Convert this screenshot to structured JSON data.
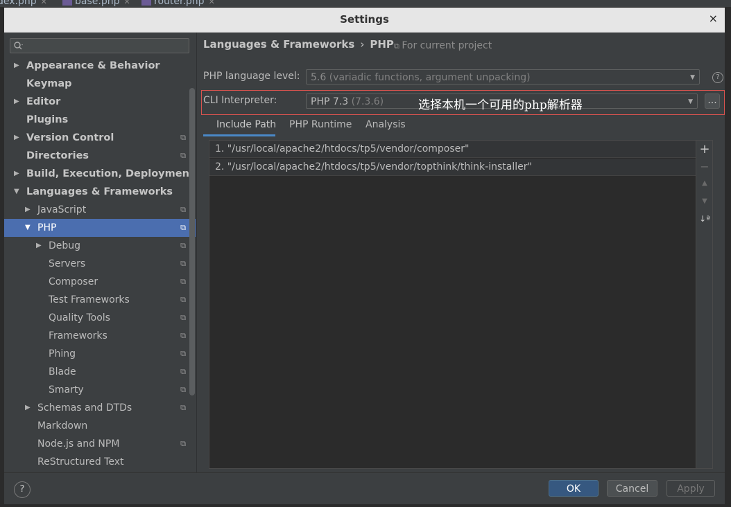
{
  "background_tabs": [
    {
      "label": "dex.php"
    },
    {
      "label": "base.php"
    },
    {
      "label": "router.php"
    }
  ],
  "dialog": {
    "title": "Settings",
    "close_glyph": "×"
  },
  "search": {
    "placeholder": "",
    "icon": "search-icon"
  },
  "sidebar": {
    "items": [
      {
        "label": "Appearance & Behavior",
        "expandable": true
      },
      {
        "label": "Keymap"
      },
      {
        "label": "Editor",
        "expandable": true
      },
      {
        "label": "Plugins"
      },
      {
        "label": "Version Control",
        "expandable": true,
        "project": true
      },
      {
        "label": "Directories",
        "project": true
      },
      {
        "label": "Build, Execution, Deployment",
        "expandable": true
      },
      {
        "label": "Languages & Frameworks",
        "expanded": true
      },
      {
        "label": "JavaScript",
        "expandable": true,
        "project": true
      },
      {
        "label": "PHP",
        "expanded": true,
        "project": true,
        "selected": true
      },
      {
        "label": "Debug",
        "expandable": true,
        "project": true
      },
      {
        "label": "Servers",
        "project": true
      },
      {
        "label": "Composer",
        "project": true
      },
      {
        "label": "Test Frameworks",
        "project": true
      },
      {
        "label": "Quality Tools",
        "project": true
      },
      {
        "label": "Frameworks",
        "project": true
      },
      {
        "label": "Phing",
        "project": true
      },
      {
        "label": "Blade",
        "project": true
      },
      {
        "label": "Smarty",
        "project": true
      },
      {
        "label": "Schemas and DTDs",
        "expandable": true,
        "project": true
      },
      {
        "label": "Markdown"
      },
      {
        "label": "Node.js and NPM",
        "project": true
      },
      {
        "label": "ReStructured Text"
      }
    ]
  },
  "breadcrumb": {
    "part1": "Languages & Frameworks",
    "sep": "›",
    "part2": "PHP",
    "for_project": "For current project"
  },
  "php_level": {
    "label": "PHP language level:",
    "value": "5.6",
    "detail": "(variadic functions, argument unpacking)"
  },
  "cli": {
    "label": "CLI Interpreter:",
    "value": "PHP 7.3",
    "detail": "(7.3.6)",
    "more": "...",
    "annotation": "选择本机一个可用的php解析器"
  },
  "tabs": [
    {
      "label": "Include Path",
      "active": true
    },
    {
      "label": "PHP Runtime"
    },
    {
      "label": "Analysis"
    }
  ],
  "include_paths": [
    "1. \"/usr/local/apache2/htdocs/tp5/vendor/composer\"",
    "2. \"/usr/local/apache2/htdocs/tp5/vendor/topthink/think-installer\""
  ],
  "tools": {
    "add": "+",
    "remove": "−",
    "up": "▲",
    "down": "▼",
    "sort": "↓ª"
  },
  "buttons": {
    "help": "?",
    "ok": "OK",
    "cancel": "Cancel",
    "apply": "Apply"
  },
  "colors": {
    "selection": "#4b6eaf",
    "highlight_box": "#d9534f",
    "primary_button": "#365880"
  }
}
